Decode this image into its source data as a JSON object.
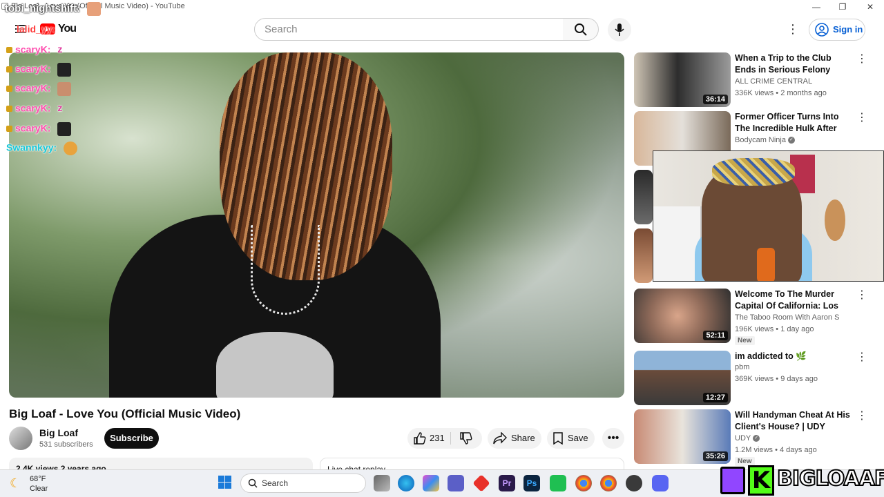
{
  "window": {
    "title": "Big Loaf - Love You(Official Music Video) - YouTube"
  },
  "header": {
    "search_placeholder": "Search",
    "signin_label": "Sign in",
    "logo_text": "You"
  },
  "chat": [
    {
      "user": "tobi_nightshift:",
      "color": "#ffffff"
    },
    {
      "user": "lalid_yy:",
      "color": "#ff3b3b"
    },
    {
      "user": "scaryK:",
      "color": "#ff4cae"
    },
    {
      "user": "scaryK:",
      "color": "#ff4cae"
    },
    {
      "user": "scaryK:",
      "color": "#ff4cae"
    },
    {
      "user": "scaryK:",
      "color": "#ff4cae"
    },
    {
      "user": "scaryK:",
      "color": "#ff4cae"
    },
    {
      "user": "Swannkyy:",
      "color": "#18c8d9"
    }
  ],
  "video": {
    "title": "Big Loaf - Love You (Official Music Video)",
    "channel": "Big Loaf",
    "subscribers": "531 subscribers",
    "subscribe_label": "Subscribe",
    "likes": "231",
    "share_label": "Share",
    "save_label": "Save",
    "description_partial": "2.4K views  2 years ago",
    "live_chat_partial": "Live chat replay"
  },
  "recommendations": [
    {
      "title": "When a Trip to the Club Ends in Serious Felony Charges",
      "channel": "ALL CRIME CENTRAL",
      "meta": "336K views • 2 months ago",
      "duration": "36:14",
      "verified": false,
      "new": false
    },
    {
      "title": "Former Officer Turns Into The Incredible Hulk After Getting ...",
      "channel": "Bodycam Ninja",
      "meta": "",
      "duration": "",
      "verified": true,
      "new": false
    },
    {
      "title": "Welcome To The Murder Capital Of California: Los Angeles",
      "channel": "The Taboo Room With Aaron S",
      "meta": "196K views • 1 day ago",
      "duration": "52:11",
      "verified": false,
      "new": true
    },
    {
      "title": "im addicted to 🌿",
      "channel": "pbm",
      "meta": "369K views • 9 days ago",
      "duration": "12:27",
      "verified": false,
      "new": false
    },
    {
      "title": "Will Handyman Cheat At His Client's House? | UDY Loyalty ...",
      "channel": "UDY",
      "meta": "1.2M views • 4 days ago",
      "duration": "35:26",
      "verified": true,
      "new": true
    }
  ],
  "new_badge": "New",
  "taskbar": {
    "temp": "68°F",
    "condition": "Clear",
    "search_label": "Search"
  },
  "branding": {
    "kick_letter": "K",
    "name": "BIGLOAAF"
  },
  "colors": {
    "youtube_red": "#ff0000",
    "signin_blue": "#065fd4",
    "kick_green": "#53fc18",
    "twitch_purple": "#9146ff"
  }
}
